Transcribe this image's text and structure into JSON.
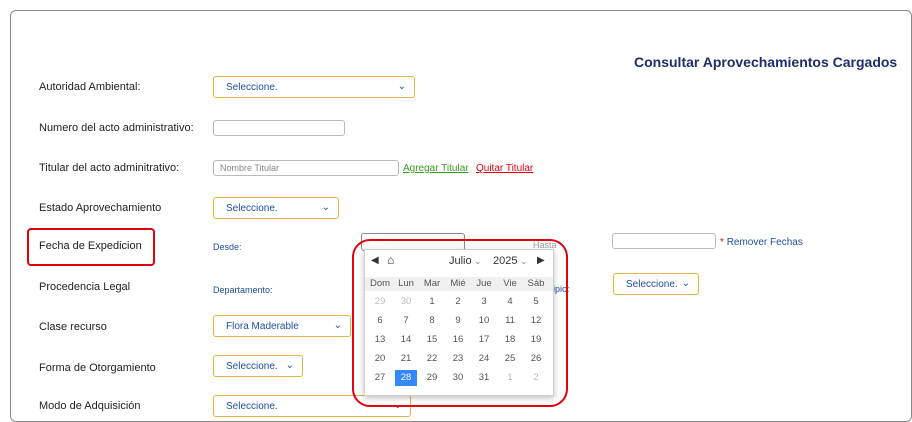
{
  "page_title": "Consultar Aprovechamientos Cargados",
  "fields": {
    "autoridad": {
      "label": "Autoridad Ambiental:",
      "value": "Seleccione."
    },
    "numero": {
      "label": "Numero del acto administrativo:",
      "value": ""
    },
    "titular": {
      "label": "Titular del acto adminitrativo:",
      "placeholder": "Nombre Titular",
      "add_link": "Agregar Titular",
      "remove_link": "Quitar Titular"
    },
    "estado": {
      "label": "Estado Aprovechamiento",
      "value": "Seleccione."
    },
    "fecha": {
      "label": "Fecha de Expedicion",
      "desde": "Desde:",
      "hasta": "Hasta",
      "remove_dates": "Remover Fechas",
      "required_mark": "*"
    },
    "procedencia": {
      "label": "Procedencia Legal",
      "departamento": "Departamento:",
      "municipio_partial": "ipio:",
      "municipio_value": "Seleccione."
    },
    "clase": {
      "label": "Clase recurso",
      "value": "Flora Maderable"
    },
    "forma": {
      "label": "Forma de Otorgamiento",
      "value": "Seleccione."
    },
    "modo": {
      "label": "Modo de Adquisición",
      "value": "Seleccione."
    }
  },
  "calendar": {
    "month": "Julio",
    "year": "2025",
    "weekdays": [
      "Dom",
      "Lun",
      "Mar",
      "Mié",
      "Jue",
      "Vie",
      "Sáb"
    ],
    "weeks": [
      [
        "29",
        "30",
        "1",
        "2",
        "3",
        "4",
        "5"
      ],
      [
        "6",
        "7",
        "8",
        "9",
        "10",
        "11",
        "12"
      ],
      [
        "13",
        "14",
        "15",
        "16",
        "17",
        "18",
        "19"
      ],
      [
        "20",
        "21",
        "22",
        "23",
        "24",
        "25",
        "26"
      ],
      [
        "27",
        "28",
        "29",
        "30",
        "31",
        "1",
        "2"
      ]
    ],
    "selected": "28"
  },
  "icons": {
    "prev": "◀",
    "home": "⌂",
    "next": "▶",
    "caret": "⌄",
    "chevron": "⌄"
  },
  "colors": {
    "accent": "#1f2d6b",
    "link_green": "#3a9a1f",
    "link_red": "#e3000f",
    "highlight": "#e3000f",
    "selected_day": "#3388ff"
  }
}
